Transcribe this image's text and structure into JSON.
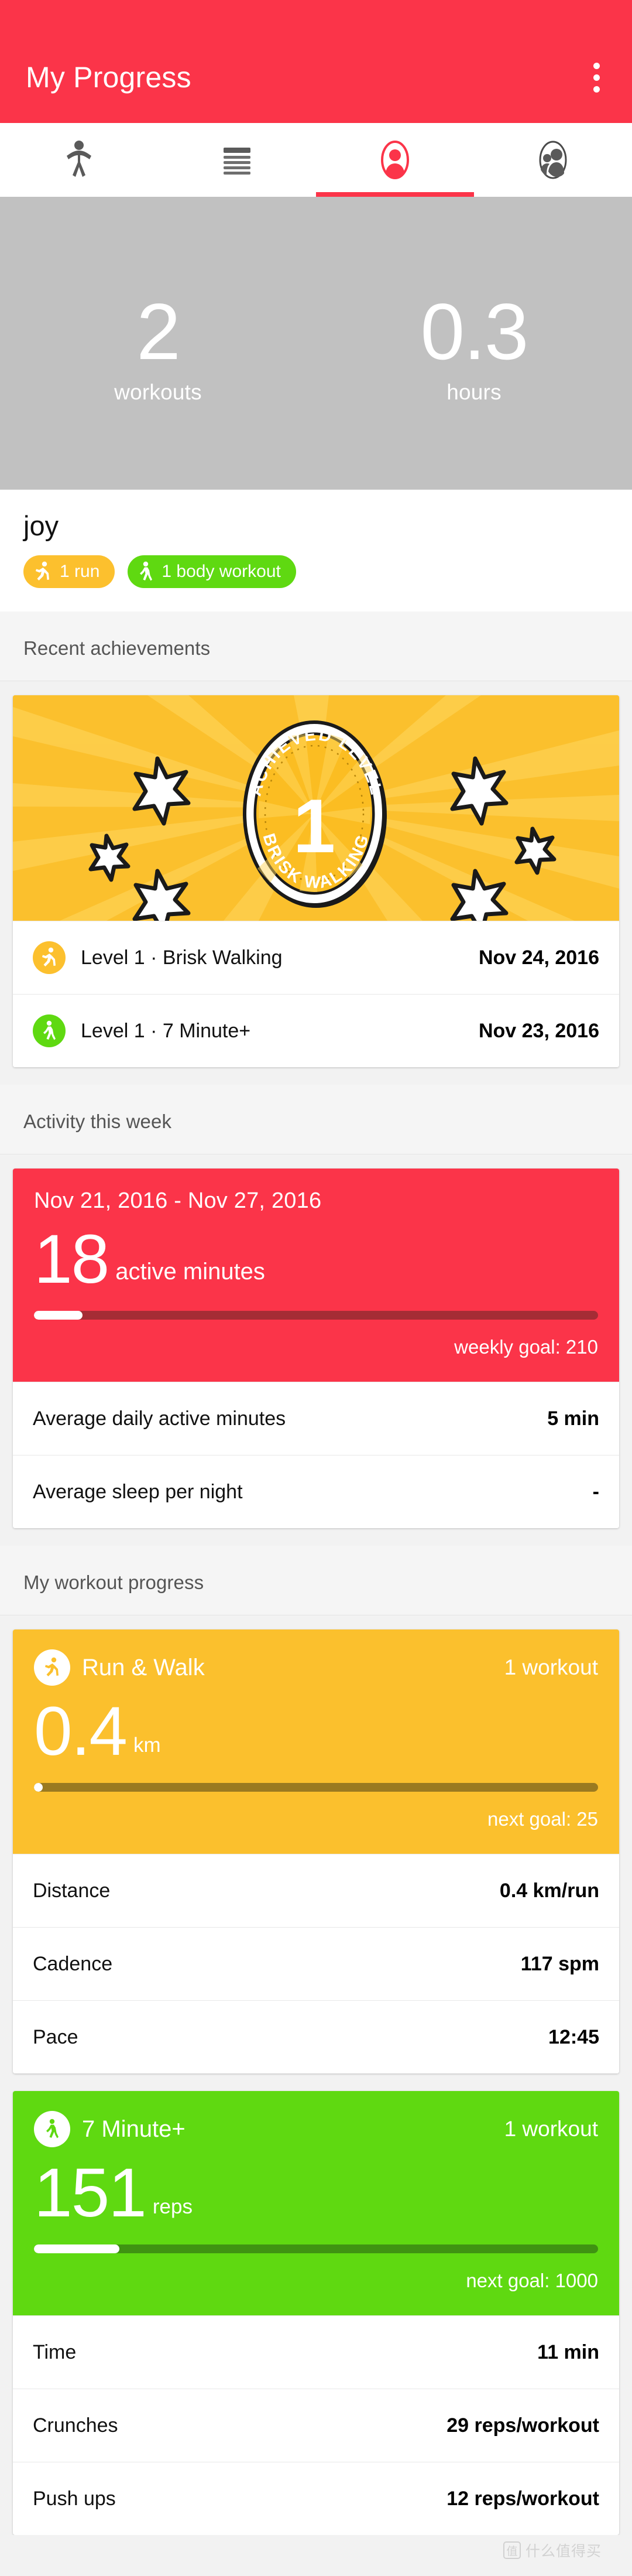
{
  "appbar": {
    "title": "My Progress",
    "overflow_icon": "more-vert-icon",
    "bg_color": "#fb3449"
  },
  "tabs": [
    {
      "id": "workouts",
      "icon": "exercise-figure-icon",
      "active": false
    },
    {
      "id": "feed",
      "icon": "list-lines-icon",
      "active": false
    },
    {
      "id": "me",
      "icon": "profile-person-icon",
      "active": true
    },
    {
      "id": "friends",
      "icon": "people-group-icon",
      "active": false
    }
  ],
  "hero": {
    "workouts_value": "2",
    "workouts_label": "workouts",
    "hours_value": "0.3",
    "hours_label": "hours",
    "bg_color": "#c1c1c1"
  },
  "profile": {
    "name": "joy",
    "chips": [
      {
        "label": "1 run",
        "icon": "runner-icon",
        "color": "#fcc02e"
      },
      {
        "label": "1 body workout",
        "icon": "walker-icon",
        "color": "#5fd911"
      }
    ]
  },
  "achievements": {
    "section_title": "Recent achievements",
    "banner": {
      "arc_top_text": "ACHIEVED LEVEL",
      "level_number": "1",
      "arc_bottom_text": "BRISK WALKING",
      "bg_color": "#fbc02d"
    },
    "rows": [
      {
        "icon": "runner-icon",
        "icon_color": "#fcc02e",
        "label": "Level 1 · Brisk Walking",
        "date": "Nov 24, 2016"
      },
      {
        "icon": "walker-icon",
        "icon_color": "#5fd911",
        "label": "Level 1 · 7 Minute+",
        "date": "Nov 23, 2016"
      }
    ]
  },
  "activity_week": {
    "section_title": "Activity this week",
    "date_range": "Nov 21, 2016 - Nov 27, 2016",
    "value": "18",
    "unit": "active minutes",
    "goal_text": "weekly goal: 210",
    "progress_percent": 8.6,
    "bg_color": "#fb3449",
    "rows": [
      {
        "label": "Average daily active minutes",
        "value": "5 min"
      },
      {
        "label": "Average sleep per night",
        "value": "-"
      }
    ]
  },
  "workout_progress": {
    "section_title": "My workout progress",
    "cards": [
      {
        "id": "run-walk",
        "icon": "runner-icon",
        "title": "Run & Walk",
        "count": "1 workout",
        "value": "0.4",
        "unit": "km",
        "goal_text": "next goal: 25",
        "progress_percent": 1.6,
        "bg_color": "#fbc02d",
        "rows": [
          {
            "label": "Distance",
            "value": "0.4 km/run"
          },
          {
            "label": "Cadence",
            "value": "117 spm"
          },
          {
            "label": "Pace",
            "value": "12:45"
          }
        ]
      },
      {
        "id": "seven-minute-plus",
        "icon": "walker-icon",
        "title": "7 Minute+",
        "count": "1 workout",
        "value": "151",
        "unit": "reps",
        "goal_text": "next goal: 1000",
        "progress_percent": 15.1,
        "bg_color": "#5fd911",
        "rows": [
          {
            "label": "Time",
            "value": "11 min"
          },
          {
            "label": "Crunches",
            "value": "29 reps/workout"
          },
          {
            "label": "Push ups",
            "value": "12 reps/workout"
          }
        ]
      }
    ]
  },
  "watermark": {
    "text": "什么值得买",
    "mark": "值"
  }
}
